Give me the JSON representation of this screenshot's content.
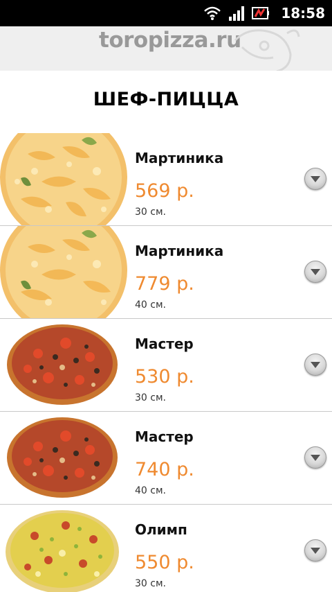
{
  "status_bar": {
    "time": "18:58",
    "icons": [
      "wifi-icon",
      "signal-icon",
      "battery-icon"
    ]
  },
  "header": {
    "logo_text": "toropizza.ru"
  },
  "page": {
    "title": "ШЕФ-ПИЦЦА"
  },
  "items": [
    {
      "name": "Мартиника",
      "price": "569 р.",
      "size": "30 см.",
      "pizza_style": "martinika",
      "icon": "chevron-down-icon"
    },
    {
      "name": "Мартиника",
      "price": "779 р.",
      "size": "40 см.",
      "pizza_style": "martinika",
      "icon": "chevron-down-icon"
    },
    {
      "name": "Мастер",
      "price": "530 р.",
      "size": "30 см.",
      "pizza_style": "master",
      "icon": "chevron-down-icon"
    },
    {
      "name": "Мастер",
      "price": "740 р.",
      "size": "40 см.",
      "pizza_style": "master",
      "icon": "chevron-down-icon"
    },
    {
      "name": "Олимп",
      "price": "550 р.",
      "size": "30 см.",
      "pizza_style": "olimp",
      "icon": "chevron-down-icon"
    }
  ],
  "colors": {
    "price": "#ef8a30",
    "status_bar": "#000000",
    "header_bg": "#efefef",
    "logo": "#999999"
  }
}
